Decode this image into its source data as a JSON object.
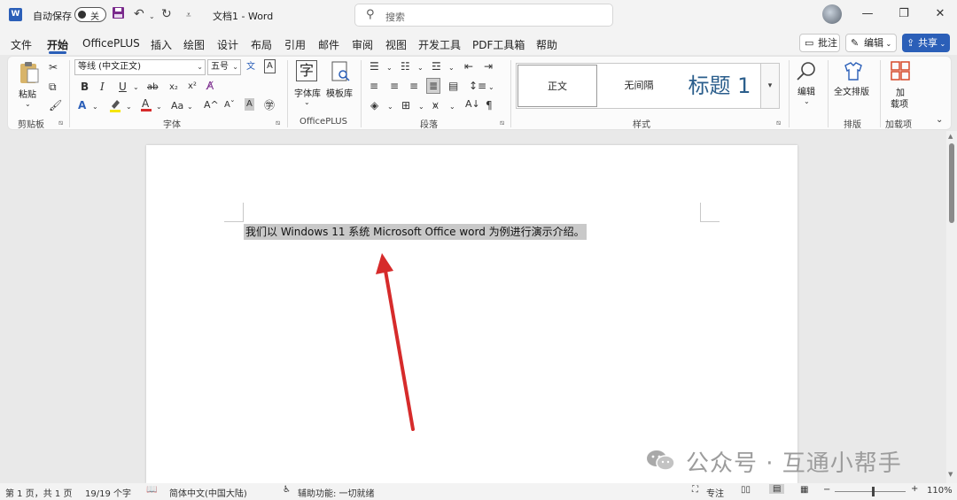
{
  "titlebar": {
    "app_icon": "W",
    "autosave_label": "自动保存",
    "autosave_state": "关",
    "doc_title": "文档1 - Word",
    "search_placeholder": "搜索",
    "icons": [
      "save-icon",
      "undo-icon",
      "redo-icon",
      "customize-icon",
      "search-icon"
    ]
  },
  "menu": {
    "tabs": [
      "文件",
      "开始",
      "OfficePLUS",
      "插入",
      "绘图",
      "设计",
      "布局",
      "引用",
      "邮件",
      "审阅",
      "视图",
      "开发工具",
      "PDF工具箱",
      "帮助"
    ],
    "active": "开始",
    "comment_label": "批注",
    "edit_label": "编辑",
    "share_label": "共享"
  },
  "ribbon": {
    "clipboard": {
      "paste_label": "粘贴",
      "group_label": "剪贴板"
    },
    "font": {
      "font_name": "等线 (中文正文)",
      "font_size": "五号",
      "group_label": "字体"
    },
    "officeplus": {
      "font_library_label": "字体库",
      "template_library_label": "模板库",
      "group_label": "OfficePLUS"
    },
    "paragraph": {
      "group_label": "段落"
    },
    "styles": {
      "items": [
        "正文",
        "无间隔",
        "标题 1"
      ],
      "group_label": "样式"
    },
    "editing": {
      "edit_label": "编辑"
    },
    "layout": {
      "full_layout_label": "全文排版",
      "group_label": "排版"
    },
    "addins": {
      "addins_label_1": "加",
      "addins_label_2": "载项",
      "group_label": "加载项"
    }
  },
  "document": {
    "text": "我们以 Windows 11 系统 Microsoft Office word 为例进行演示介绍。",
    "arrow_color": "#d62b2b"
  },
  "watermark": {
    "text": "公众号 · 互通小帮手"
  },
  "statusbar": {
    "page": "第 1 页，共 1 页",
    "words": "19/19 个字",
    "language": "简体中文(中国大陆)",
    "accessibility": "辅助功能: 一切就绪",
    "focus": "专注",
    "zoom": "110%"
  },
  "colors": {
    "accent": "#2b5fb8",
    "selection": "#c9c9c9"
  }
}
